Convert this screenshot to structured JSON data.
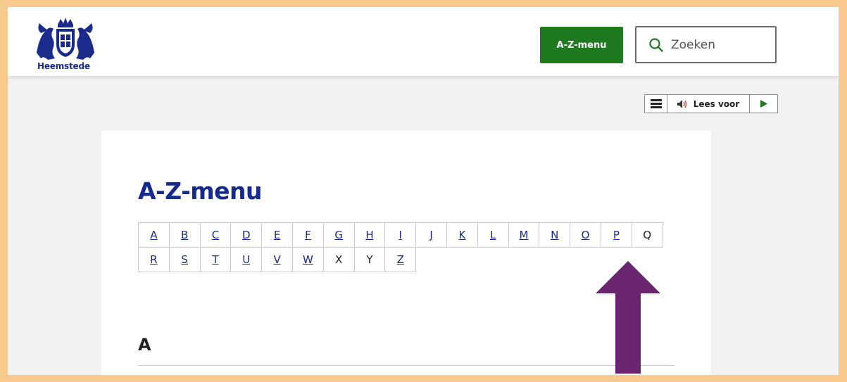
{
  "header": {
    "logo_text": "Heemstede",
    "az_button_label": "A-Z-menu",
    "search_placeholder": "Zoeken"
  },
  "tts": {
    "menu_icon": "hamburger-icon",
    "read_label": "Lees voor",
    "speaker_icon": "speaker-icon",
    "play_icon": "play-icon"
  },
  "main": {
    "title": "A-Z-menu",
    "letters_row1": [
      "A",
      "B",
      "C",
      "D",
      "E",
      "F",
      "G",
      "H",
      "I",
      "J",
      "K",
      "L",
      "M",
      "N",
      "O",
      "P",
      "Q"
    ],
    "letters_row2": [
      "R",
      "S",
      "T",
      "U",
      "V",
      "W",
      "X",
      "Y",
      "Z"
    ],
    "unlinked_letters": [
      "Q",
      "X",
      "Y"
    ],
    "section_heading": "A"
  },
  "colors": {
    "accent_green": "#1f7a1f",
    "title_blue": "#152a8a",
    "frame_orange": "#f7c98c",
    "arrow_purple": "#6b2470"
  }
}
